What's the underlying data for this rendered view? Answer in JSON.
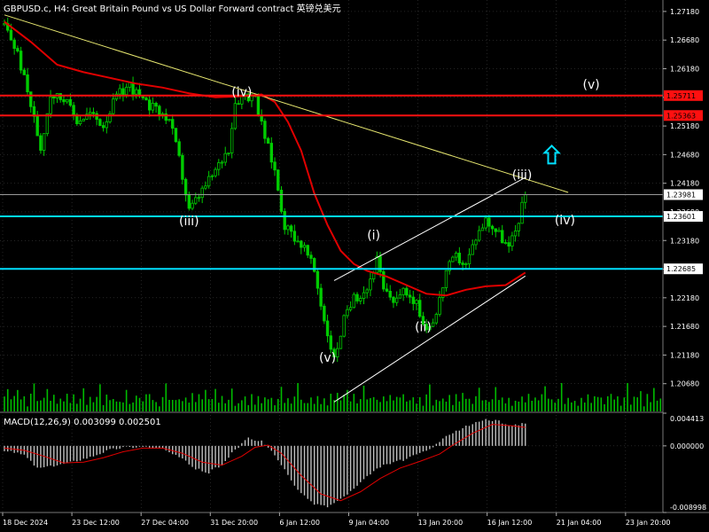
{
  "header": {
    "title": "GBPUSD.c, H4:  Great Britain Pound vs US Dollar Forward contract  英镑兑美元"
  },
  "macd_panel": {
    "label": "MACD(12,26,9) 0.003099 0.002501"
  },
  "colors": {
    "background": "#000000",
    "grid": "#4a4a4a",
    "candle": "#00cc00",
    "volume": "#00bb00",
    "moving_average": "#e00000",
    "trendline": "#e8e870",
    "channel": "#ffffff",
    "resistance": "#ff1010",
    "support": "#00e0ff",
    "current_price": "#999999",
    "arrow": "#00e0ff",
    "macd_histogram": "#c0c0c0",
    "macd_signal": "#e00000"
  },
  "chart_data": [
    {
      "type": "candlestick",
      "title": "GBPUSD.c, H4:  Great Britain Pound vs US Dollar Forward contract  英镑兑美元",
      "y_ticks": [
        "1.27180",
        "1.26680",
        "1.26180",
        "1.25680",
        "1.25180",
        "1.24680",
        "1.24180",
        "1.23680",
        "1.23180",
        "1.22680",
        "1.22180",
        "1.21680",
        "1.21180",
        "1.20680"
      ],
      "ylim": [
        1.2018,
        1.2738
      ],
      "x_labels": [
        "18 Dec 2024",
        "23 Dec 12:00",
        "27 Dec 04:00",
        "31 Dec 20:00",
        "6 Jan 12:00",
        "9 Jan 04:00",
        "13 Jan 20:00",
        "16 Jan 12:00",
        "21 Jan 04:00",
        "23 Jan 20:00"
      ],
      "bar_count": 200,
      "price_path": [
        [
          0,
          1.2695
        ],
        [
          4,
          1.2645
        ],
        [
          8,
          1.2555
        ],
        [
          11,
          1.248
        ],
        [
          14,
          1.2575
        ],
        [
          18,
          1.2565
        ],
        [
          22,
          1.2528
        ],
        [
          26,
          1.254
        ],
        [
          30,
          1.252
        ],
        [
          34,
          1.257
        ],
        [
          38,
          1.259
        ],
        [
          42,
          1.256
        ],
        [
          46,
          1.2545
        ],
        [
          50,
          1.253
        ],
        [
          53,
          1.246
        ],
        [
          56,
          1.237
        ],
        [
          60,
          1.2405
        ],
        [
          64,
          1.244
        ],
        [
          68,
          1.248
        ],
        [
          70,
          1.256
        ],
        [
          73,
          1.2575
        ],
        [
          76,
          1.2562
        ],
        [
          78,
          1.252
        ],
        [
          82,
          1.244
        ],
        [
          85,
          1.2345
        ],
        [
          88,
          1.2325
        ],
        [
          91,
          1.2305
        ],
        [
          94,
          1.2265
        ],
        [
          97,
          1.218
        ],
        [
          100,
          1.211
        ],
        [
          103,
          1.218
        ],
        [
          106,
          1.2215
        ],
        [
          110,
          1.2235
        ],
        [
          113,
          1.2285
        ],
        [
          115,
          1.223
        ],
        [
          118,
          1.2215
        ],
        [
          122,
          1.223
        ],
        [
          125,
          1.2205
        ],
        [
          128,
          1.2165
        ],
        [
          131,
          1.219
        ],
        [
          134,
          1.2265
        ],
        [
          137,
          1.229
        ],
        [
          140,
          1.2275
        ],
        [
          143,
          1.2325
        ],
        [
          146,
          1.2355
        ],
        [
          150,
          1.233
        ],
        [
          153,
          1.2305
        ],
        [
          155,
          1.2335
        ],
        [
          158,
          1.24
        ]
      ],
      "moving_average": [
        [
          0,
          1.27
        ],
        [
          8,
          1.2665
        ],
        [
          16,
          1.2625
        ],
        [
          24,
          1.2612
        ],
        [
          32,
          1.2602
        ],
        [
          40,
          1.2592
        ],
        [
          48,
          1.2585
        ],
        [
          56,
          1.2575
        ],
        [
          64,
          1.2568
        ],
        [
          72,
          1.257
        ],
        [
          78,
          1.2573
        ],
        [
          82,
          1.256
        ],
        [
          86,
          1.2525
        ],
        [
          90,
          1.2475
        ],
        [
          94,
          1.24
        ],
        [
          98,
          1.2345
        ],
        [
          102,
          1.23
        ],
        [
          106,
          1.2277
        ],
        [
          110,
          1.2265
        ],
        [
          116,
          1.2255
        ],
        [
          122,
          1.224
        ],
        [
          128,
          1.2225
        ],
        [
          134,
          1.2222
        ],
        [
          140,
          1.2232
        ],
        [
          146,
          1.2238
        ],
        [
          152,
          1.224
        ],
        [
          158,
          1.2262
        ]
      ],
      "trendline": [
        [
          0,
          1.2712
        ],
        [
          171,
          1.2402
        ]
      ],
      "channel_lines": [
        [
          [
            100,
            1.2248
          ],
          [
            158,
            1.2428
          ]
        ],
        [
          [
            100,
            1.2036
          ],
          [
            158,
            1.2256
          ]
        ]
      ],
      "horizontal_levels": [
        {
          "price": "1.25711",
          "value": 1.25711,
          "kind": "resistance"
        },
        {
          "price": "1.25363",
          "value": 1.25363,
          "kind": "resistance"
        },
        {
          "price": "1.23981",
          "value": 1.23981,
          "kind": "current"
        },
        {
          "price": "1.23601",
          "value": 1.23601,
          "kind": "support"
        },
        {
          "price": "1.22685",
          "value": 1.22685,
          "kind": "support"
        }
      ],
      "wave_labels": [
        {
          "text": "(iv)",
          "bar": 72,
          "price": 1.257
        },
        {
          "text": "(iii)",
          "bar": 56,
          "price": 1.2345
        },
        {
          "text": "(i)",
          "bar": 112,
          "price": 1.232
        },
        {
          "text": "(ii)",
          "bar": 127,
          "price": 1.216
        },
        {
          "text": "(v)",
          "bar": 98,
          "price": 1.2106
        },
        {
          "text": "(iii)",
          "bar": 157,
          "price": 1.2425
        },
        {
          "text": "(iv)",
          "bar": 170,
          "price": 1.2346
        },
        {
          "text": "(v)",
          "bar": 178,
          "price": 1.2583
        }
      ],
      "arrow": {
        "direction": "up",
        "bar": 166,
        "price": 1.2468
      },
      "volume_levels": [
        0.45,
        0.7,
        0.35,
        0.5,
        0.8,
        0.4,
        0.55,
        0.3,
        0.6,
        0.9,
        0.35,
        0.5,
        0.45,
        0.65,
        0.3,
        0.5,
        0.4,
        0.7,
        0.35,
        0.55
      ]
    },
    {
      "type": "histogram+line",
      "title": "MACD(12,26,9) 0.003099 0.002501",
      "y_ticks": [
        "0.004413",
        "0.000000",
        "-0.008998"
      ],
      "ylim": [
        -0.008998,
        0.004413
      ],
      "histogram": [
        [
          0,
          -0.0006
        ],
        [
          6,
          -0.0012
        ],
        [
          10,
          -0.003
        ],
        [
          14,
          -0.0028
        ],
        [
          20,
          -0.0022
        ],
        [
          26,
          -0.0015
        ],
        [
          32,
          -0.0005
        ],
        [
          36,
          -0.0002
        ],
        [
          42,
          -0.0001
        ],
        [
          48,
          -0.0004
        ],
        [
          54,
          -0.0018
        ],
        [
          58,
          -0.0031
        ],
        [
          62,
          -0.0036
        ],
        [
          66,
          -0.0025
        ],
        [
          70,
          -0.0005
        ],
        [
          74,
          0.001
        ],
        [
          78,
          0.0006
        ],
        [
          82,
          -0.0012
        ],
        [
          86,
          -0.004
        ],
        [
          90,
          -0.0065
        ],
        [
          94,
          -0.0078
        ],
        [
          98,
          -0.0082
        ],
        [
          102,
          -0.0072
        ],
        [
          106,
          -0.0058
        ],
        [
          110,
          -0.0042
        ],
        [
          114,
          -0.0028
        ],
        [
          118,
          -0.0022
        ],
        [
          122,
          -0.0018
        ],
        [
          126,
          -0.001
        ],
        [
          130,
          -0.0002
        ],
        [
          134,
          0.0012
        ],
        [
          138,
          0.0022
        ],
        [
          142,
          0.003
        ],
        [
          146,
          0.0036
        ],
        [
          150,
          0.0033
        ],
        [
          154,
          0.0027
        ],
        [
          158,
          0.0031
        ]
      ],
      "signal": [
        [
          0,
          -0.0003
        ],
        [
          6,
          -0.0006
        ],
        [
          12,
          -0.0014
        ],
        [
          18,
          -0.0023
        ],
        [
          24,
          -0.0022
        ],
        [
          30,
          -0.0016
        ],
        [
          36,
          -0.0008
        ],
        [
          42,
          -0.0003
        ],
        [
          48,
          -0.0003
        ],
        [
          54,
          -0.001
        ],
        [
          60,
          -0.0022
        ],
        [
          66,
          -0.0026
        ],
        [
          72,
          -0.0014
        ],
        [
          76,
          -0.0002
        ],
        [
          80,
          0.0001
        ],
        [
          84,
          -0.001
        ],
        [
          90,
          -0.004
        ],
        [
          96,
          -0.0065
        ],
        [
          102,
          -0.0074
        ],
        [
          108,
          -0.0062
        ],
        [
          114,
          -0.0044
        ],
        [
          120,
          -0.003
        ],
        [
          126,
          -0.0021
        ],
        [
          132,
          -0.0011
        ],
        [
          136,
          0.0001
        ],
        [
          142,
          0.0017
        ],
        [
          148,
          0.0029
        ],
        [
          154,
          0.0027
        ],
        [
          158,
          0.0025
        ]
      ]
    }
  ]
}
